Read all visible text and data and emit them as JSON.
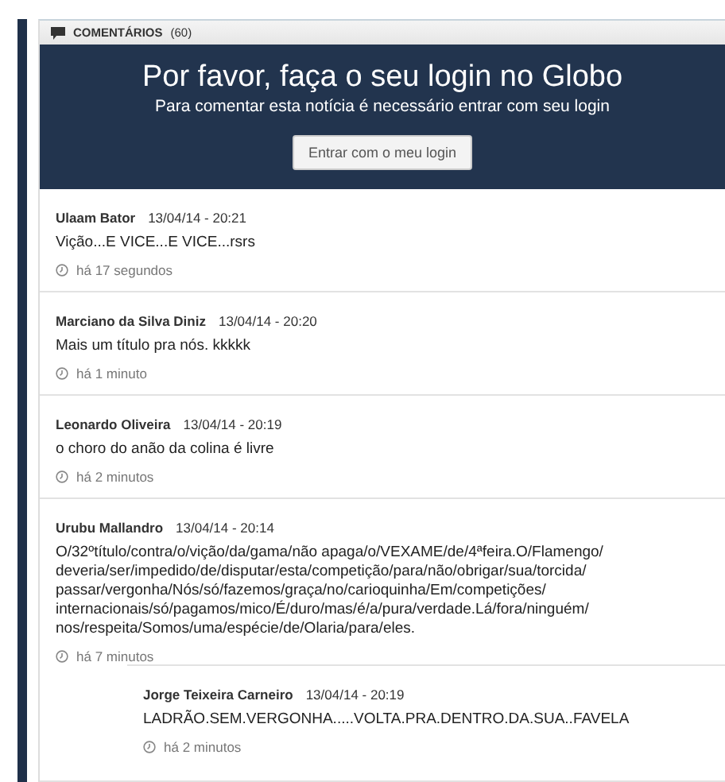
{
  "header": {
    "title": "COMENTÁRIOS",
    "count": "(60)"
  },
  "login": {
    "title": "Por favor, faça o seu login no Globo",
    "subtitle": "Para comentar esta notícia é necessário entrar com seu login",
    "button": "Entrar com o meu login"
  },
  "comments": [
    {
      "author": "Ulaam Bator",
      "date": "13/04/14 - 20:21",
      "text": "Vição...E VICE...E VICE...rsrs",
      "time": "há 17 segundos"
    },
    {
      "author": "Marciano da Silva Diniz",
      "date": "13/04/14 - 20:20",
      "text": "Mais um título pra nós. kkkkk",
      "time": "há 1 minuto"
    },
    {
      "author": "Leonardo Oliveira",
      "date": "13/04/14 - 20:19",
      "text": "o choro do anão da colina é livre",
      "time": "há 2 minutos"
    },
    {
      "author": "Urubu Mallandro",
      "date": "13/04/14 - 20:14",
      "text": "O/32ºtítulo/contra/o/vição/da/gama/não apaga/o/VEXAME/de/4ªfeira.O/Flamengo/\ndeveria/ser/impedido/de/disputar/esta/competição/para/não/obrigar/sua/torcida/\npassar/vergonha/Nós/só/fazemos/graça/no/carioquinha/Em/competições/\ninternacionais/só/pagamos/mico/É/duro/mas/é/a/pura/verdade.Lá/fora/ninguém/\nnos/respeita/Somos/uma/espécie/de/Olaria/para/eles.",
      "time": "há 7 minutos",
      "children": [
        {
          "author": "Jorge Teixeira Carneiro",
          "date": "13/04/14 - 20:19",
          "text": "LADRÃO.SEM.VERGONHA.....VOLTA.PRA.DENTRO.DA.SUA..FAVELA",
          "time": "há 2 minutos"
        }
      ]
    }
  ]
}
